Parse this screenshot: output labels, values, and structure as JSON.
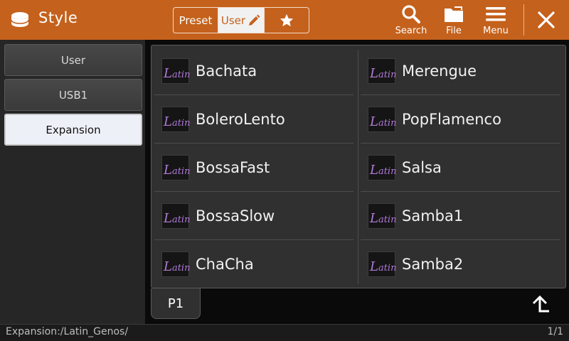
{
  "header": {
    "title": "Style",
    "tabs": {
      "preset": "Preset",
      "user": "User"
    },
    "buttons": {
      "search": "Search",
      "file": "File",
      "menu": "Menu"
    }
  },
  "sidebar": {
    "items": [
      {
        "label": "User",
        "active": false
      },
      {
        "label": "USB1",
        "active": false
      },
      {
        "label": "Expansion",
        "active": true
      }
    ]
  },
  "styles": {
    "category_badge": "Latin",
    "left": [
      "Bachata",
      "BoleroLento",
      "BossaFast",
      "BossaSlow",
      "ChaCha"
    ],
    "right": [
      "Merengue",
      "PopFlamenco",
      "Salsa",
      "Samba1",
      "Samba2"
    ]
  },
  "page_tab": "P1",
  "status": {
    "path": "Expansion:/Latin_Genos/",
    "pages": "1/1"
  },
  "colors": {
    "header": "#c4611c",
    "badge_text": "#b27ad8",
    "active_item": "#eef0f8"
  },
  "icons": [
    "drum-icon",
    "pencil-icon",
    "star-icon",
    "search-icon",
    "folder-icon",
    "menu-icon",
    "close-icon",
    "up-arrow-icon"
  ]
}
